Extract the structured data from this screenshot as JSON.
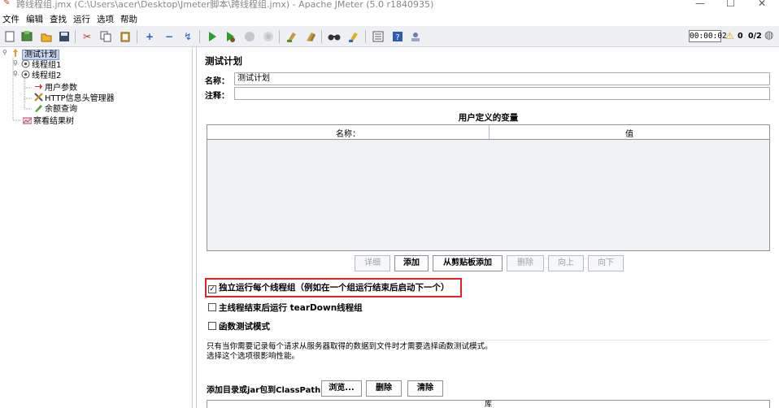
{
  "window": {
    "title": "跨线程组.jmx (C:\\Users\\acer\\Desktop\\Jmeter脚本\\跨线程组.jmx) - Apache JMeter (5.0 r1840935)"
  },
  "menu": [
    "文件",
    "编辑",
    "查找",
    "运行",
    "选项",
    "帮助"
  ],
  "toolbar": {
    "timer": "00:00:02",
    "warnings": "0",
    "threads": "0/2"
  },
  "tree": {
    "root": "测试计划",
    "items": [
      "线程组1",
      "线程组2",
      "用户参数",
      "HTTP信息头管理器",
      "余额查询",
      "察看结果树"
    ]
  },
  "panel": {
    "title": "测试计划",
    "name_label": "名称：",
    "name_value": "测试计划",
    "comment_label": "注释：",
    "comment_value": "",
    "udv_title": "用户定义的变量",
    "table_headers": [
      "名称：",
      "值"
    ],
    "buttons": [
      "详细",
      "添加",
      "从剪贴板添加",
      "删除",
      "向上",
      "向下"
    ],
    "checkboxes": [
      {
        "label": "独立运行每个线程组（例如在一个组运行结束后启动下一个）",
        "checked": true
      },
      {
        "label": "主线程结束后运行 tearDown线程组",
        "checked": false
      },
      {
        "label": "函数测试模式",
        "checked": false
      }
    ],
    "note_lines": [
      "只有当你需要记录每个请求从服务器取得的数据到文件时才需要选择函数测试模式。",
      "选择这个选项很影响性能。"
    ],
    "classpath_label": "添加目录或jar包到ClassPath",
    "classpath_buttons": [
      "浏览...",
      "删除",
      "清除"
    ],
    "classpath_header": "库"
  }
}
